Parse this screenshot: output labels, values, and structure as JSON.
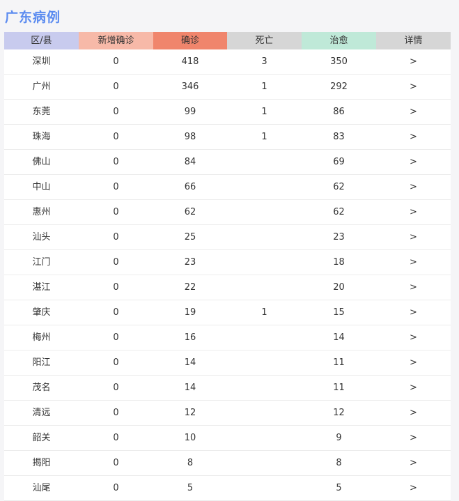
{
  "title": "广东病例",
  "columns": [
    {
      "label": "区/县",
      "color": "#c8cbee"
    },
    {
      "label": "新增确诊",
      "color": "#f7b9a8"
    },
    {
      "label": "确诊",
      "color": "#f0856c"
    },
    {
      "label": "死亡",
      "color": "#d6d6d6"
    },
    {
      "label": "治愈",
      "color": "#bfe9d8"
    },
    {
      "label": "详情",
      "color": "#d6d6d6"
    }
  ],
  "rows": [
    {
      "region": "深圳",
      "new": "0",
      "confirmed": "418",
      "deaths": "3",
      "cured": "350",
      "detail": ">"
    },
    {
      "region": "广州",
      "new": "0",
      "confirmed": "346",
      "deaths": "1",
      "cured": "292",
      "detail": ">"
    },
    {
      "region": "东莞",
      "new": "0",
      "confirmed": "99",
      "deaths": "1",
      "cured": "86",
      "detail": ">"
    },
    {
      "region": "珠海",
      "new": "0",
      "confirmed": "98",
      "deaths": "1",
      "cured": "83",
      "detail": ">"
    },
    {
      "region": "佛山",
      "new": "0",
      "confirmed": "84",
      "deaths": "",
      "cured": "69",
      "detail": ">"
    },
    {
      "region": "中山",
      "new": "0",
      "confirmed": "66",
      "deaths": "",
      "cured": "62",
      "detail": ">"
    },
    {
      "region": "惠州",
      "new": "0",
      "confirmed": "62",
      "deaths": "",
      "cured": "62",
      "detail": ">"
    },
    {
      "region": "汕头",
      "new": "0",
      "confirmed": "25",
      "deaths": "",
      "cured": "23",
      "detail": ">"
    },
    {
      "region": "江门",
      "new": "0",
      "confirmed": "23",
      "deaths": "",
      "cured": "18",
      "detail": ">"
    },
    {
      "region": "湛江",
      "new": "0",
      "confirmed": "22",
      "deaths": "",
      "cured": "20",
      "detail": ">"
    },
    {
      "region": "肇庆",
      "new": "0",
      "confirmed": "19",
      "deaths": "1",
      "cured": "15",
      "detail": ">"
    },
    {
      "region": "梅州",
      "new": "0",
      "confirmed": "16",
      "deaths": "",
      "cured": "14",
      "detail": ">"
    },
    {
      "region": "阳江",
      "new": "0",
      "confirmed": "14",
      "deaths": "",
      "cured": "11",
      "detail": ">"
    },
    {
      "region": "茂名",
      "new": "0",
      "confirmed": "14",
      "deaths": "",
      "cured": "11",
      "detail": ">"
    },
    {
      "region": "清远",
      "new": "0",
      "confirmed": "12",
      "deaths": "",
      "cured": "12",
      "detail": ">"
    },
    {
      "region": "韶关",
      "new": "0",
      "confirmed": "10",
      "deaths": "",
      "cured": "9",
      "detail": ">"
    },
    {
      "region": "揭阳",
      "new": "0",
      "confirmed": "8",
      "deaths": "",
      "cured": "8",
      "detail": ">"
    },
    {
      "region": "汕尾",
      "new": "0",
      "confirmed": "5",
      "deaths": "",
      "cured": "5",
      "detail": ">"
    }
  ]
}
